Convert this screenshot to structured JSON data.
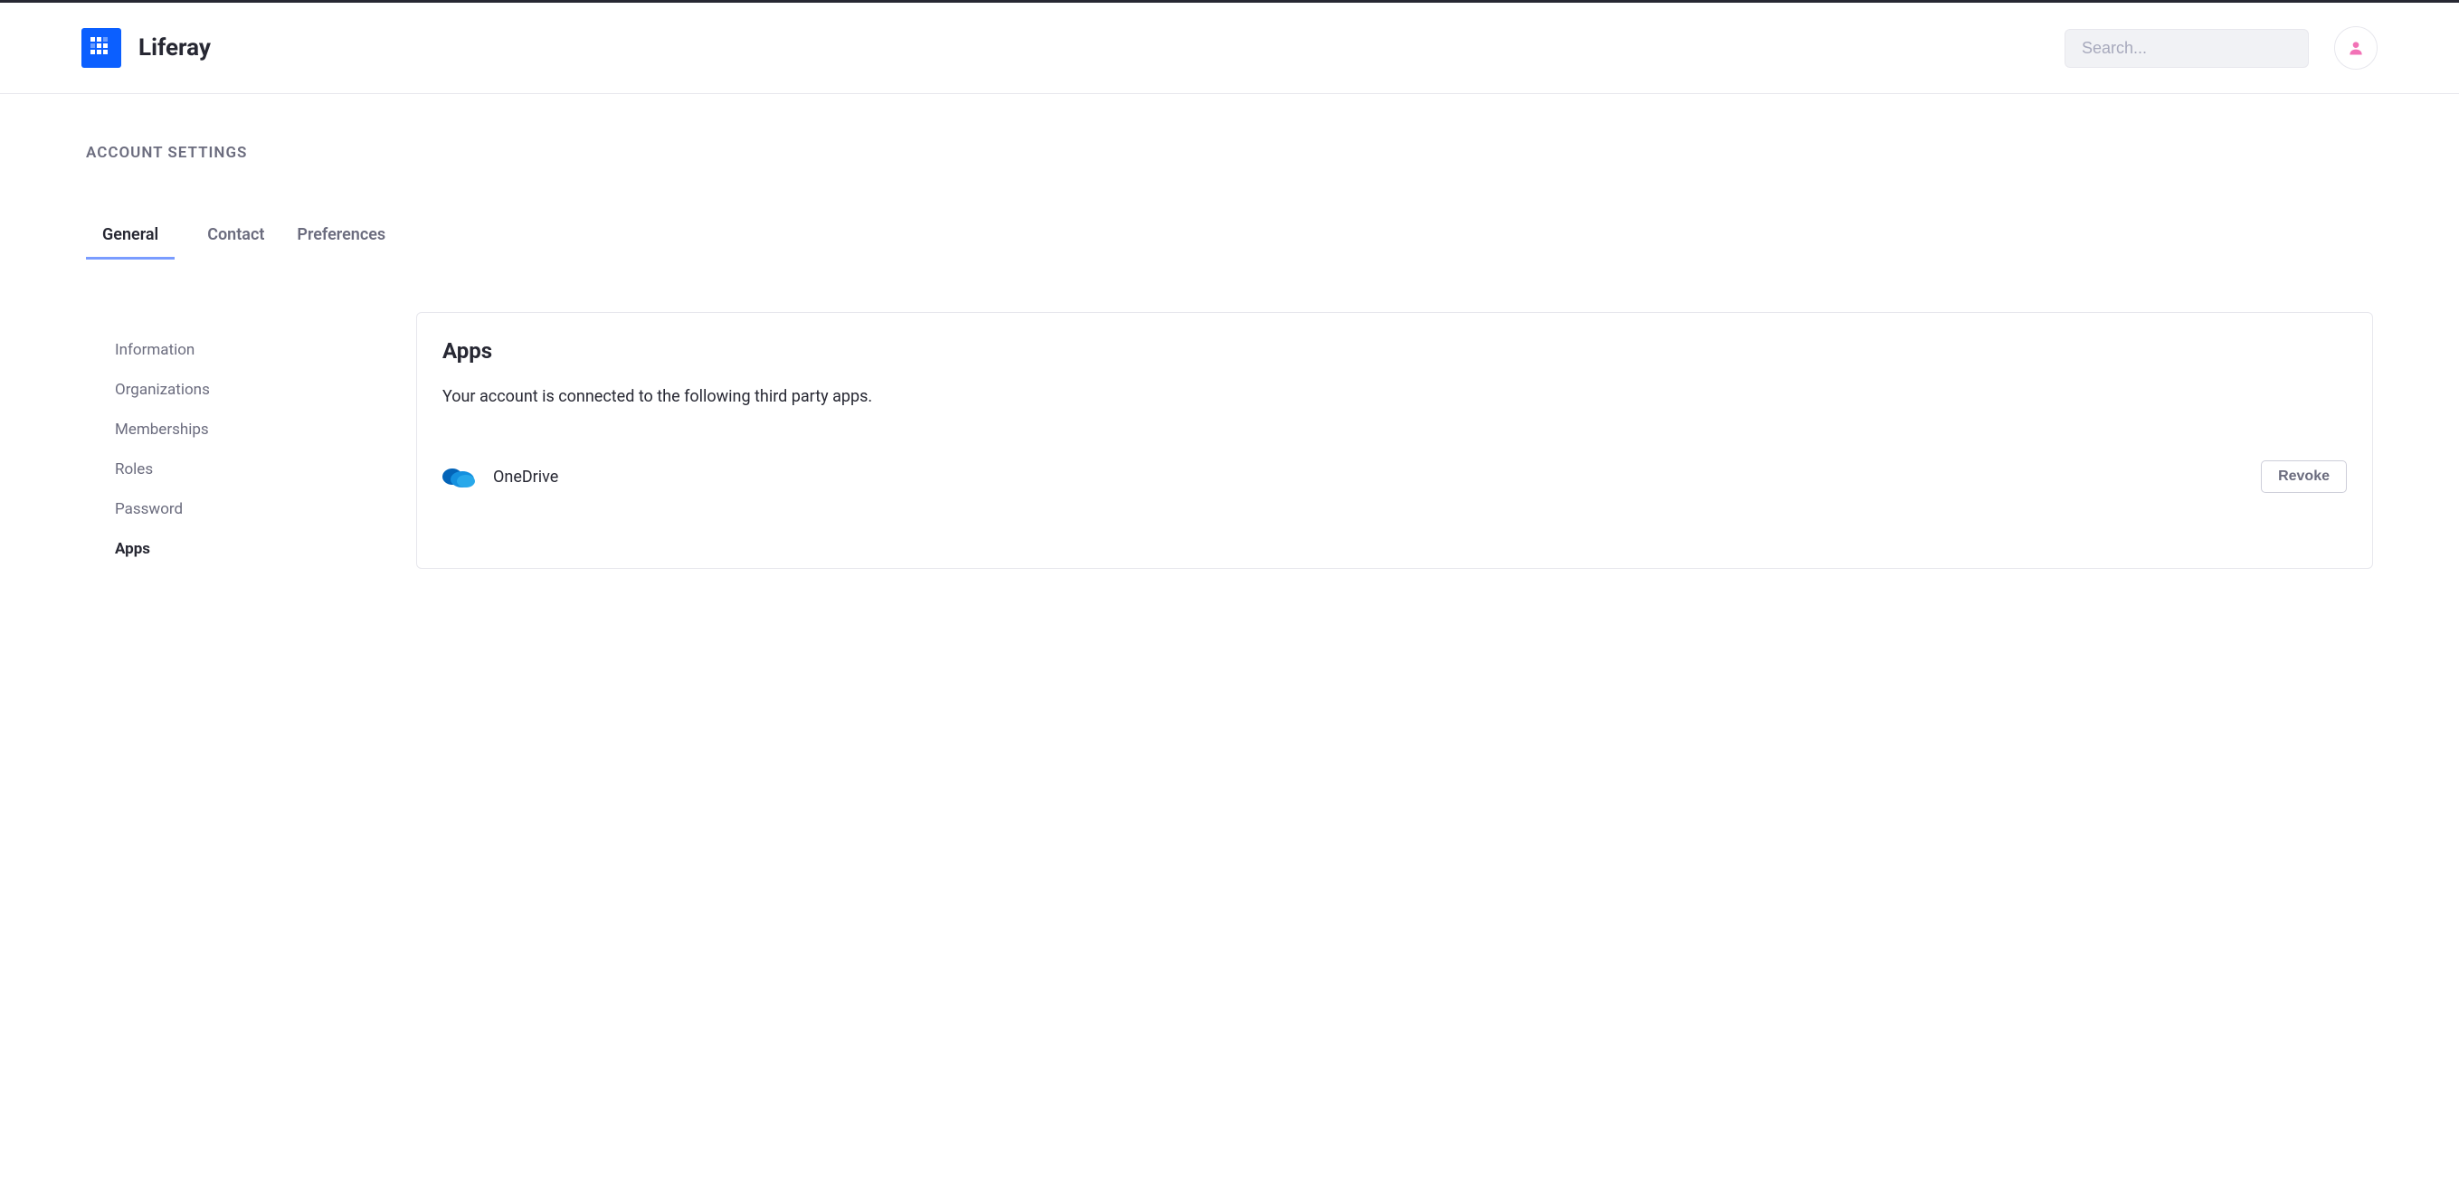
{
  "header": {
    "brand_name": "Liferay",
    "search_placeholder": "Search..."
  },
  "page": {
    "label": "ACCOUNT SETTINGS"
  },
  "tabs": [
    {
      "label": "General",
      "active": true
    },
    {
      "label": "Contact",
      "active": false
    },
    {
      "label": "Preferences",
      "active": false
    }
  ],
  "sidebar": {
    "items": [
      {
        "label": "Information",
        "active": false
      },
      {
        "label": "Organizations",
        "active": false
      },
      {
        "label": "Memberships",
        "active": false
      },
      {
        "label": "Roles",
        "active": false
      },
      {
        "label": "Password",
        "active": false
      },
      {
        "label": "Apps",
        "active": true
      }
    ]
  },
  "panel": {
    "title": "Apps",
    "description": "Your account is connected to the following third party apps.",
    "apps": [
      {
        "name": "OneDrive",
        "revoke_label": "Revoke",
        "icon": "onedrive-icon"
      }
    ]
  }
}
